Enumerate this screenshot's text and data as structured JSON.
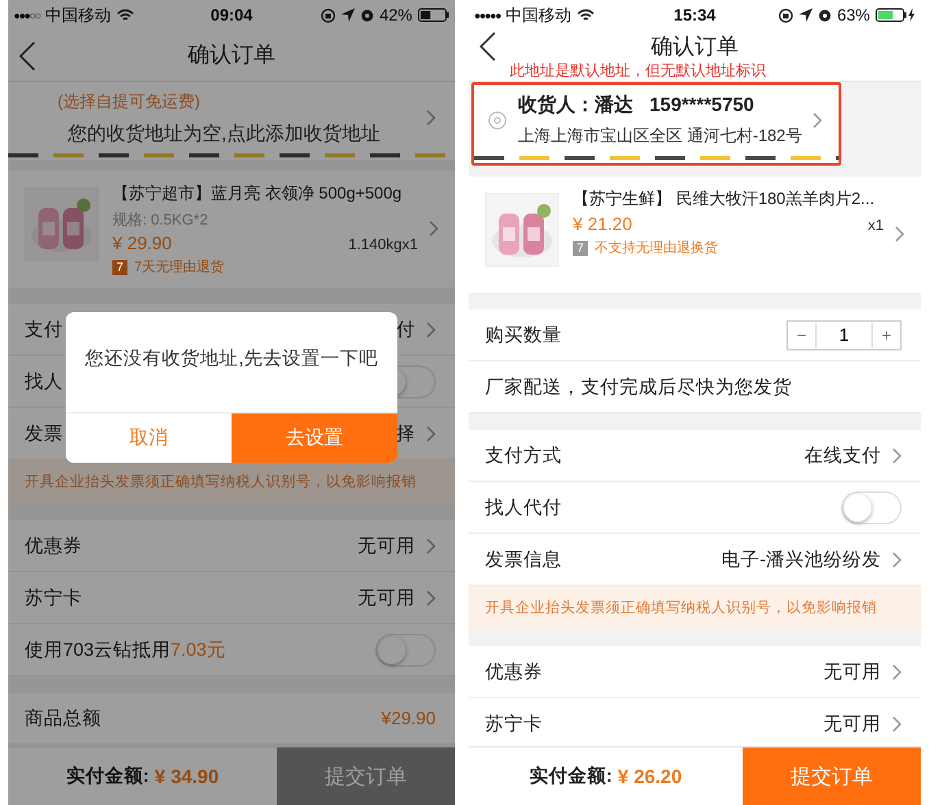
{
  "phones": [
    {
      "status_bar": {
        "signal": "●●●○○",
        "carrier": "中国移动",
        "time": "09:04",
        "battery": "42%",
        "charging": false
      },
      "nav": {
        "title": "确认订单"
      },
      "address": {
        "kind": "empty",
        "hint": "(选择自提可免运费)",
        "text": "您的收货地址为空,点此添加收货地址",
        "highlighted": false
      },
      "product": {
        "title": "【苏宁超市】蓝月亮 衣领净 500g+500g",
        "spec": "规格: 0.5KG*2",
        "price": "¥ 29.90",
        "quantity": "1.140kgx1",
        "badge": {
          "text": "7",
          "color": "#954513"
        },
        "policy": "7天无理由退货"
      },
      "sections": [
        {
          "rows": [
            {
              "kind": "link",
              "label": "支付",
              "value": "付"
            },
            {
              "kind": "toggle",
              "label": "找人",
              "on": false
            },
            {
              "kind": "link",
              "label": "发票",
              "value": "择"
            },
            {
              "kind": "notice",
              "text": "开具企业抬头发票须正确填写纳税人识别号，以免影响报销"
            }
          ]
        },
        {
          "rows": [
            {
              "kind": "link",
              "label": "优惠券",
              "value": "无可用"
            },
            {
              "kind": "link",
              "label": "苏宁卡",
              "value": "无可用"
            },
            {
              "kind": "toggle",
              "label": "使用703云钻抵用",
              "highlight": "7.03元",
              "on": false
            }
          ]
        },
        {
          "rows": [
            {
              "kind": "total",
              "label": "商品总额",
              "value": "¥29.90"
            }
          ]
        }
      ],
      "footer": {
        "label": "实付金额:",
        "amount": "¥ 34.90",
        "submit": {
          "label": "提交订单",
          "disabled": true
        }
      },
      "dialog": {
        "message": "您还没有收货地址,先去设置一下吧",
        "buttons": [
          {
            "label": "取消",
            "kind": "secondary"
          },
          {
            "label": "去设置",
            "kind": "primary"
          }
        ]
      }
    },
    {
      "status_bar": {
        "signal": "●●●●●",
        "carrier": "中国移动",
        "time": "15:34",
        "battery": "63%",
        "charging": true
      },
      "nav": {
        "title": "确认订单",
        "annotation": "此地址是默认地址，但无默认地址标识"
      },
      "address": {
        "kind": "filled",
        "recipient": "收货人：潘达",
        "phone": "159****5750",
        "detail": "上海上海市宝山区全区 通河七村-182号",
        "highlighted": true
      },
      "product": {
        "title": "【苏宁生鲜】 民维大牧汗180羔羊肉片2...",
        "price": "¥ 21.20",
        "quantity": "x1",
        "badge": {
          "text": "7",
          "color": "#9a9a9a"
        },
        "policy": "不支持无理由退换货"
      },
      "sections": [
        {
          "rows": [
            {
              "kind": "stepper",
              "label": "购买数量",
              "minus": "−",
              "value": "1",
              "plus": "+"
            },
            {
              "kind": "text",
              "text": "厂家配送，支付完成后尽快为您发货"
            }
          ]
        },
        {
          "rows": [
            {
              "kind": "link",
              "label": "支付方式",
              "value": "在线支付"
            },
            {
              "kind": "toggle",
              "label": "找人代付",
              "on": false
            },
            {
              "kind": "link",
              "label": "发票信息",
              "value": "电子-潘兴池纷纷发"
            },
            {
              "kind": "notice",
              "text": "开具企业抬头发票须正确填写纳税人识别号，以免影响报销"
            }
          ]
        },
        {
          "rows": [
            {
              "kind": "link",
              "label": "优惠券",
              "value": "无可用"
            },
            {
              "kind": "link",
              "label": "苏宁卡",
              "value": "无可用"
            }
          ]
        }
      ],
      "footer": {
        "label": "实付金额:",
        "amount": "¥ 26.20",
        "submit": {
          "label": "提交订单",
          "disabled": false
        }
      }
    }
  ]
}
